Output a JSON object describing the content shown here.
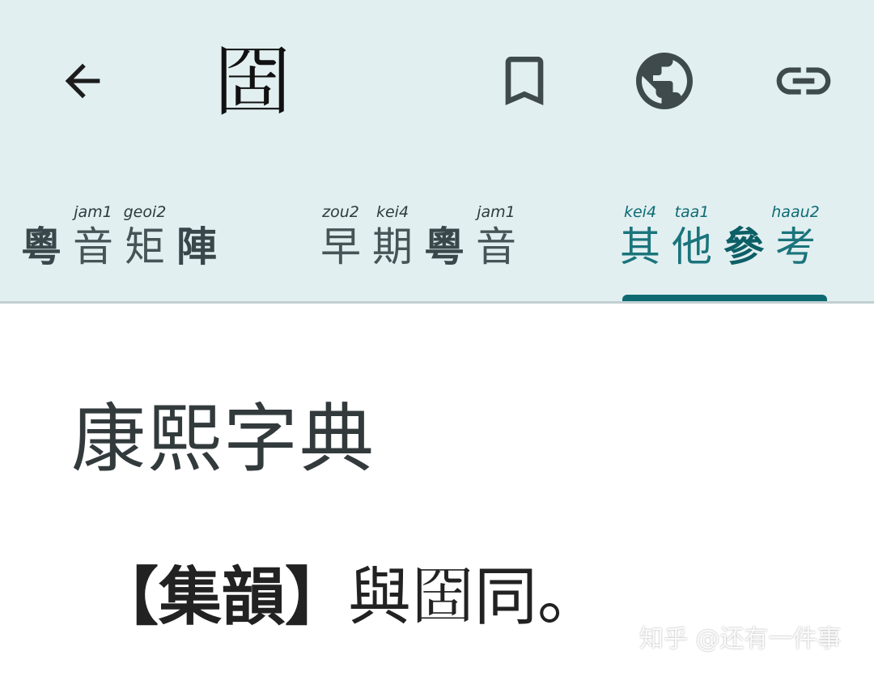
{
  "app": {
    "title_char": "𡇣",
    "icons": {
      "back": "arrow-back-icon",
      "bookmark": "bookmark-icon",
      "globe": "globe-icon",
      "link": "link-icon"
    },
    "colors": {
      "appbar_bg": "#e2eff1",
      "accent": "#0e6a71"
    }
  },
  "tabs": [
    {
      "ruby": [
        {
          "char": "粵",
          "rom": "",
          "bold": true
        },
        {
          "char": "音",
          "rom": "jam1",
          "bold": false
        },
        {
          "char": "矩",
          "rom": "geoi2",
          "bold": false
        },
        {
          "char": "陣",
          "rom": "",
          "bold": true
        }
      ]
    },
    {
      "ruby": [
        {
          "char": "早",
          "rom": "zou2",
          "bold": false
        },
        {
          "char": "期",
          "rom": "kei4",
          "bold": false
        },
        {
          "char": "粵",
          "rom": "",
          "bold": true
        },
        {
          "char": "音",
          "rom": "jam1",
          "bold": false
        }
      ]
    },
    {
      "active": true,
      "ruby": [
        {
          "char": "其",
          "rom": "kei4",
          "bold": false
        },
        {
          "char": "他",
          "rom": "taa1",
          "bold": false
        },
        {
          "char": "參",
          "rom": "",
          "bold": true
        },
        {
          "char": "考",
          "rom": "haau2",
          "bold": false
        }
      ]
    }
  ],
  "content": {
    "section_title": "康熙字典",
    "entry_source": "【集韻】",
    "entry_text": "與𡇣同。"
  },
  "watermark": "知乎 @还有一件事"
}
